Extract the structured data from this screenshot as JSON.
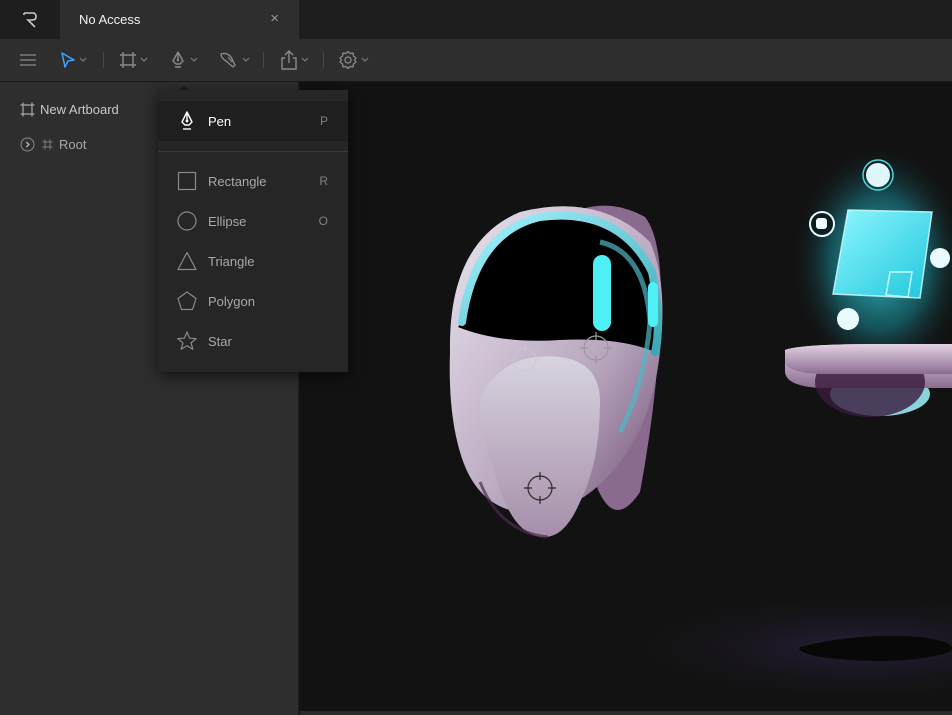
{
  "app": {
    "tab_title": "No Access",
    "tab_close": "×"
  },
  "toolbar": {
    "tools": [
      "menu-icon",
      "select-tool-icon",
      "artboard-tool-icon",
      "pen-tool-icon",
      "brush-tool-icon",
      "export-icon",
      "settings-icon"
    ],
    "accent": "#3ba3ff"
  },
  "layers": {
    "artboard_label": "New Artboard",
    "root_label": "Root"
  },
  "pen_menu": {
    "items": [
      {
        "label": "Pen",
        "shortcut": "P",
        "icon": "pen-icon",
        "selected": true
      },
      {
        "label": "Rectangle",
        "shortcut": "R",
        "icon": "rectangle-icon"
      },
      {
        "label": "Ellipse",
        "shortcut": "O",
        "icon": "ellipse-icon"
      },
      {
        "label": "Triangle",
        "shortcut": "",
        "icon": "triangle-icon"
      },
      {
        "label": "Polygon",
        "shortcut": "",
        "icon": "polygon-icon"
      },
      {
        "label": "Star",
        "shortcut": "",
        "icon": "star-icon"
      }
    ]
  },
  "colors": {
    "panel": "#2e2e2e",
    "canvas": "#121212",
    "cyan": "#3de6f0",
    "mauve": "#b89aae"
  }
}
